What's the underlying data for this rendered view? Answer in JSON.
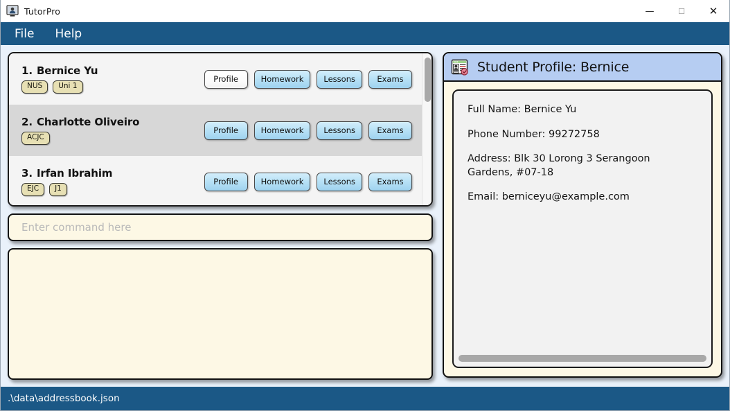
{
  "window": {
    "title": "TutorPro",
    "icon": "app-tutor-icon",
    "controls": {
      "minimize": "—",
      "maximize": "☐",
      "close": "✕"
    }
  },
  "menubar": {
    "items": [
      {
        "label": "File"
      },
      {
        "label": "Help"
      }
    ]
  },
  "student_list": {
    "row_buttons": [
      "Profile",
      "Homework",
      "Lessons",
      "Exams"
    ],
    "rows": [
      {
        "index": "1.",
        "name": "Bernice Yu",
        "tags": [
          "NUS",
          "Uni 1"
        ],
        "selected": false,
        "active_button": "Profile"
      },
      {
        "index": "2.",
        "name": "Charlotte Oliveiro",
        "tags": [
          "ACJC"
        ],
        "selected": true,
        "active_button": null
      },
      {
        "index": "3.",
        "name": "Irfan Ibrahim",
        "tags": [
          "EJC",
          "J1"
        ],
        "selected": false,
        "active_button": null
      }
    ],
    "scrollbar": "vertical-scrollbar"
  },
  "command": {
    "value": "",
    "placeholder": "Enter command here"
  },
  "result": {
    "text": ""
  },
  "detail_panel": {
    "icon": "contact-card-icon",
    "title": "Student Profile: Bernice",
    "fields": [
      {
        "label": "Full Name:",
        "value": "Bernice Yu",
        "text": "Full Name: Bernice Yu"
      },
      {
        "label": "Phone Number:",
        "value": "99272758",
        "text": "Phone Number: 99272758"
      },
      {
        "label": "Address:",
        "value": "Blk 30 Lorong 3 Serangoon Gardens, #07-18",
        "text": "Address: Blk 30 Lorong 3 Serangoon\n          Gardens, #07-18"
      },
      {
        "label": "Email:",
        "value": "berniceyu@example.com",
        "text": "Email: berniceyu@example.com"
      }
    ],
    "scrollbar": "horizontal-scrollbar"
  },
  "statusbar": {
    "path": ".\\data\\addressbook.json"
  },
  "colors": {
    "chrome_blue": "#1b5886",
    "app_background": "#e9f1fa",
    "panel_cream": "#fdf8e5",
    "header_blue": "#b6cdf2",
    "row_selected": "#d7d7d7",
    "row_normal": "#f4f4f4",
    "tag_khaki": "#e7e0b4",
    "button_blue": "#b9e2f6"
  }
}
